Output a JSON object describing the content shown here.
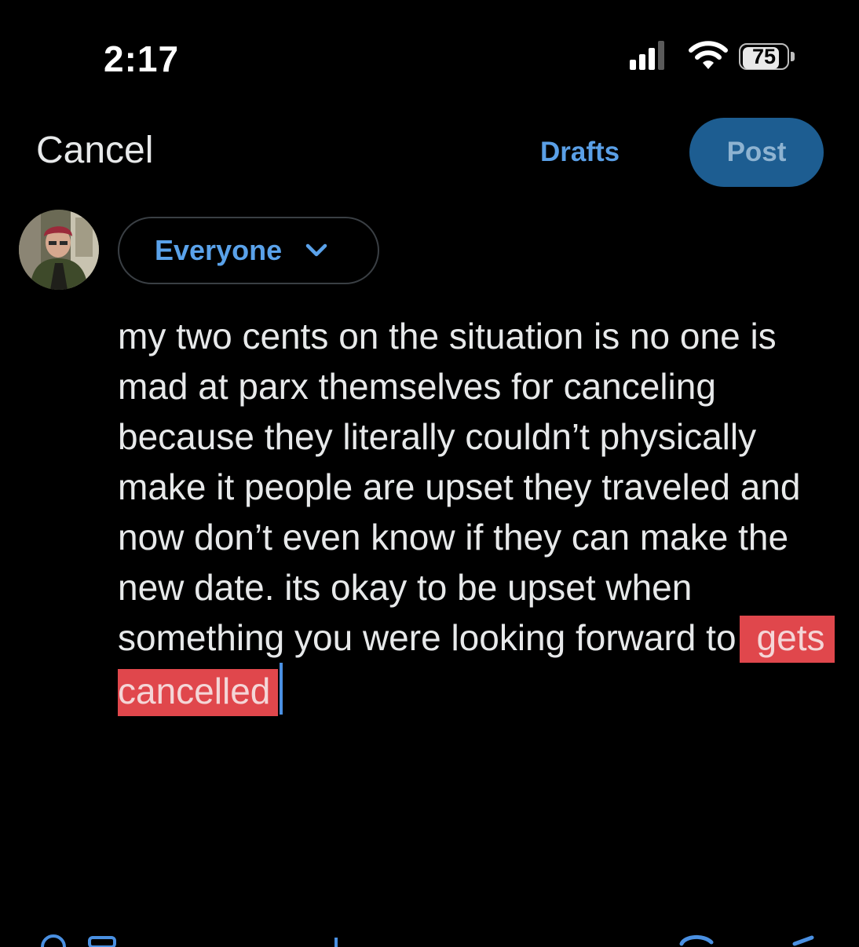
{
  "status_bar": {
    "time": "2:17",
    "battery": "75",
    "icons": [
      "signal-icon",
      "wifi-icon",
      "battery-icon"
    ]
  },
  "header": {
    "cancel_label": "Cancel",
    "drafts_label": "Drafts",
    "post_label": "Post"
  },
  "audience": {
    "label": "Everyone",
    "icon": "chevron-down-icon"
  },
  "composer": {
    "typed_text": "my two cents on the situation is no one is mad at parx themselves for canceling because they literally couldn’t physically make it people are upset they traveled and now don’t even know if they can make the new date. its okay to be upset when something you were looking forward to",
    "selected_text": "gets cancelled"
  },
  "colors": {
    "background": "#000000",
    "accent": "#5a9fe6",
    "post_button": "#1d5d91",
    "selection": "#e0474c",
    "cursor": "#4a90e2"
  }
}
